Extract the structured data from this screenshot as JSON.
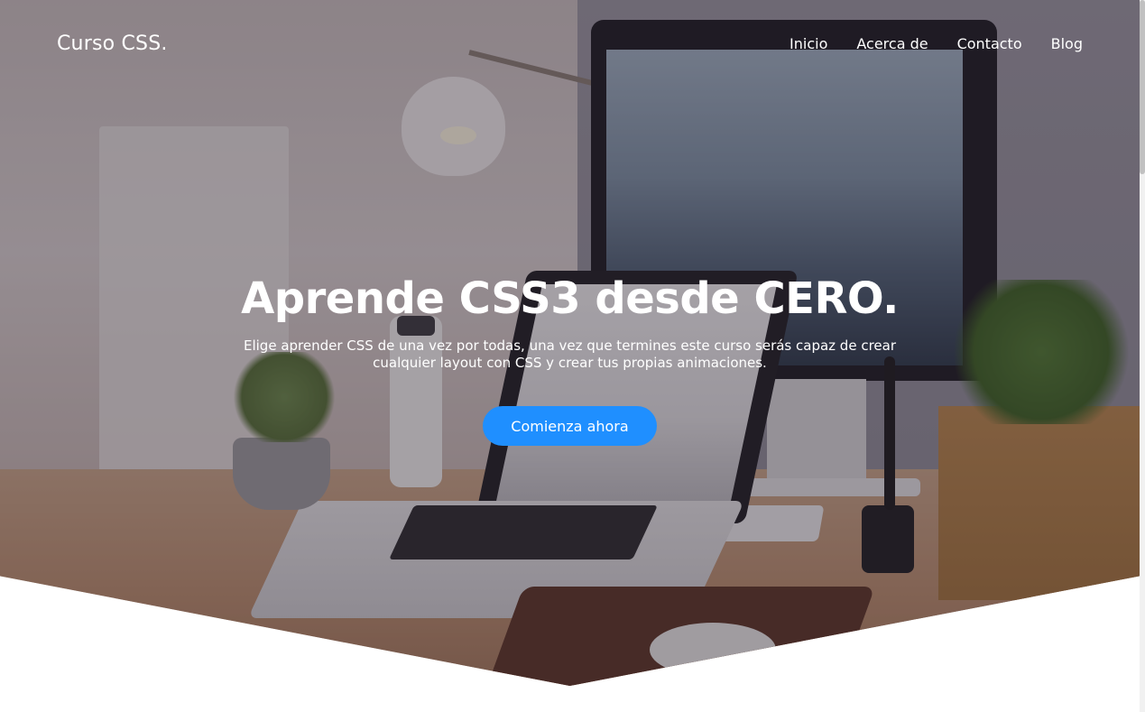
{
  "header": {
    "logo": "Curso CSS.",
    "nav": [
      {
        "label": "Inicio"
      },
      {
        "label": "Acerca de"
      },
      {
        "label": "Contacto"
      },
      {
        "label": "Blog"
      }
    ]
  },
  "hero": {
    "title": "Aprende CSS3 desde CERO.",
    "subtitle": "Elige aprender CSS de una vez por todas, una vez que termines este curso serás capaz de crear cualquier layout con CSS y crear tus propias animaciones.",
    "cta_label": "Comienza ahora",
    "background_image": "desk-workspace-photo",
    "colors": {
      "accent": "#1f8fff",
      "text": "#ffffff"
    }
  }
}
